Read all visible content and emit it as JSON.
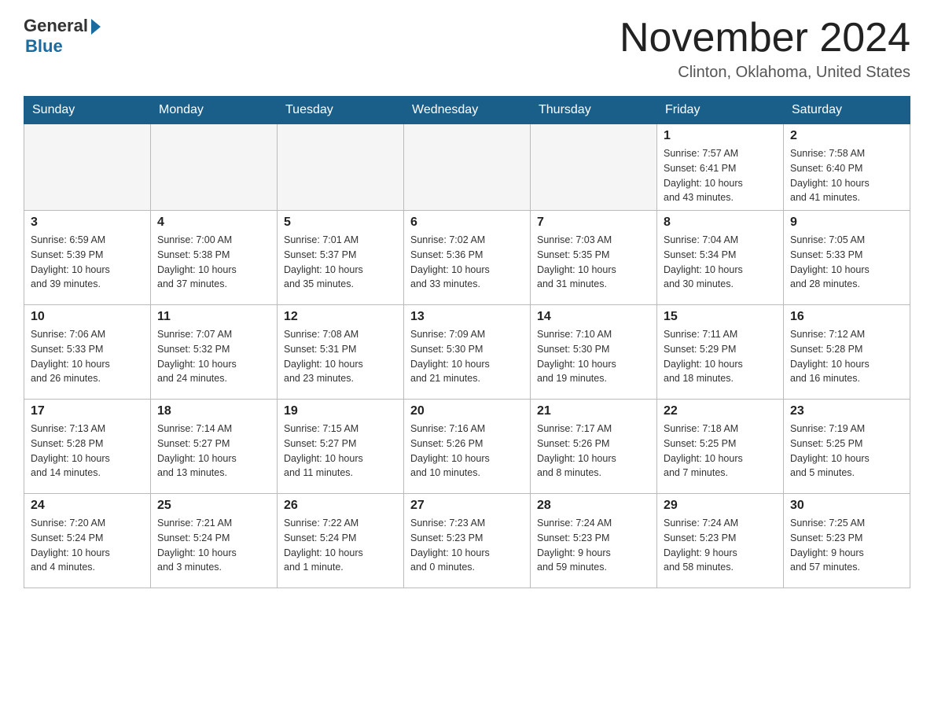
{
  "logo": {
    "general": "General",
    "blue": "Blue"
  },
  "title": "November 2024",
  "location": "Clinton, Oklahoma, United States",
  "days_of_week": [
    "Sunday",
    "Monday",
    "Tuesday",
    "Wednesday",
    "Thursday",
    "Friday",
    "Saturday"
  ],
  "weeks": [
    [
      {
        "day": "",
        "info": ""
      },
      {
        "day": "",
        "info": ""
      },
      {
        "day": "",
        "info": ""
      },
      {
        "day": "",
        "info": ""
      },
      {
        "day": "",
        "info": ""
      },
      {
        "day": "1",
        "info": "Sunrise: 7:57 AM\nSunset: 6:41 PM\nDaylight: 10 hours\nand 43 minutes."
      },
      {
        "day": "2",
        "info": "Sunrise: 7:58 AM\nSunset: 6:40 PM\nDaylight: 10 hours\nand 41 minutes."
      }
    ],
    [
      {
        "day": "3",
        "info": "Sunrise: 6:59 AM\nSunset: 5:39 PM\nDaylight: 10 hours\nand 39 minutes."
      },
      {
        "day": "4",
        "info": "Sunrise: 7:00 AM\nSunset: 5:38 PM\nDaylight: 10 hours\nand 37 minutes."
      },
      {
        "day": "5",
        "info": "Sunrise: 7:01 AM\nSunset: 5:37 PM\nDaylight: 10 hours\nand 35 minutes."
      },
      {
        "day": "6",
        "info": "Sunrise: 7:02 AM\nSunset: 5:36 PM\nDaylight: 10 hours\nand 33 minutes."
      },
      {
        "day": "7",
        "info": "Sunrise: 7:03 AM\nSunset: 5:35 PM\nDaylight: 10 hours\nand 31 minutes."
      },
      {
        "day": "8",
        "info": "Sunrise: 7:04 AM\nSunset: 5:34 PM\nDaylight: 10 hours\nand 30 minutes."
      },
      {
        "day": "9",
        "info": "Sunrise: 7:05 AM\nSunset: 5:33 PM\nDaylight: 10 hours\nand 28 minutes."
      }
    ],
    [
      {
        "day": "10",
        "info": "Sunrise: 7:06 AM\nSunset: 5:33 PM\nDaylight: 10 hours\nand 26 minutes."
      },
      {
        "day": "11",
        "info": "Sunrise: 7:07 AM\nSunset: 5:32 PM\nDaylight: 10 hours\nand 24 minutes."
      },
      {
        "day": "12",
        "info": "Sunrise: 7:08 AM\nSunset: 5:31 PM\nDaylight: 10 hours\nand 23 minutes."
      },
      {
        "day": "13",
        "info": "Sunrise: 7:09 AM\nSunset: 5:30 PM\nDaylight: 10 hours\nand 21 minutes."
      },
      {
        "day": "14",
        "info": "Sunrise: 7:10 AM\nSunset: 5:30 PM\nDaylight: 10 hours\nand 19 minutes."
      },
      {
        "day": "15",
        "info": "Sunrise: 7:11 AM\nSunset: 5:29 PM\nDaylight: 10 hours\nand 18 minutes."
      },
      {
        "day": "16",
        "info": "Sunrise: 7:12 AM\nSunset: 5:28 PM\nDaylight: 10 hours\nand 16 minutes."
      }
    ],
    [
      {
        "day": "17",
        "info": "Sunrise: 7:13 AM\nSunset: 5:28 PM\nDaylight: 10 hours\nand 14 minutes."
      },
      {
        "day": "18",
        "info": "Sunrise: 7:14 AM\nSunset: 5:27 PM\nDaylight: 10 hours\nand 13 minutes."
      },
      {
        "day": "19",
        "info": "Sunrise: 7:15 AM\nSunset: 5:27 PM\nDaylight: 10 hours\nand 11 minutes."
      },
      {
        "day": "20",
        "info": "Sunrise: 7:16 AM\nSunset: 5:26 PM\nDaylight: 10 hours\nand 10 minutes."
      },
      {
        "day": "21",
        "info": "Sunrise: 7:17 AM\nSunset: 5:26 PM\nDaylight: 10 hours\nand 8 minutes."
      },
      {
        "day": "22",
        "info": "Sunrise: 7:18 AM\nSunset: 5:25 PM\nDaylight: 10 hours\nand 7 minutes."
      },
      {
        "day": "23",
        "info": "Sunrise: 7:19 AM\nSunset: 5:25 PM\nDaylight: 10 hours\nand 5 minutes."
      }
    ],
    [
      {
        "day": "24",
        "info": "Sunrise: 7:20 AM\nSunset: 5:24 PM\nDaylight: 10 hours\nand 4 minutes."
      },
      {
        "day": "25",
        "info": "Sunrise: 7:21 AM\nSunset: 5:24 PM\nDaylight: 10 hours\nand 3 minutes."
      },
      {
        "day": "26",
        "info": "Sunrise: 7:22 AM\nSunset: 5:24 PM\nDaylight: 10 hours\nand 1 minute."
      },
      {
        "day": "27",
        "info": "Sunrise: 7:23 AM\nSunset: 5:23 PM\nDaylight: 10 hours\nand 0 minutes."
      },
      {
        "day": "28",
        "info": "Sunrise: 7:24 AM\nSunset: 5:23 PM\nDaylight: 9 hours\nand 59 minutes."
      },
      {
        "day": "29",
        "info": "Sunrise: 7:24 AM\nSunset: 5:23 PM\nDaylight: 9 hours\nand 58 minutes."
      },
      {
        "day": "30",
        "info": "Sunrise: 7:25 AM\nSunset: 5:23 PM\nDaylight: 9 hours\nand 57 minutes."
      }
    ]
  ]
}
